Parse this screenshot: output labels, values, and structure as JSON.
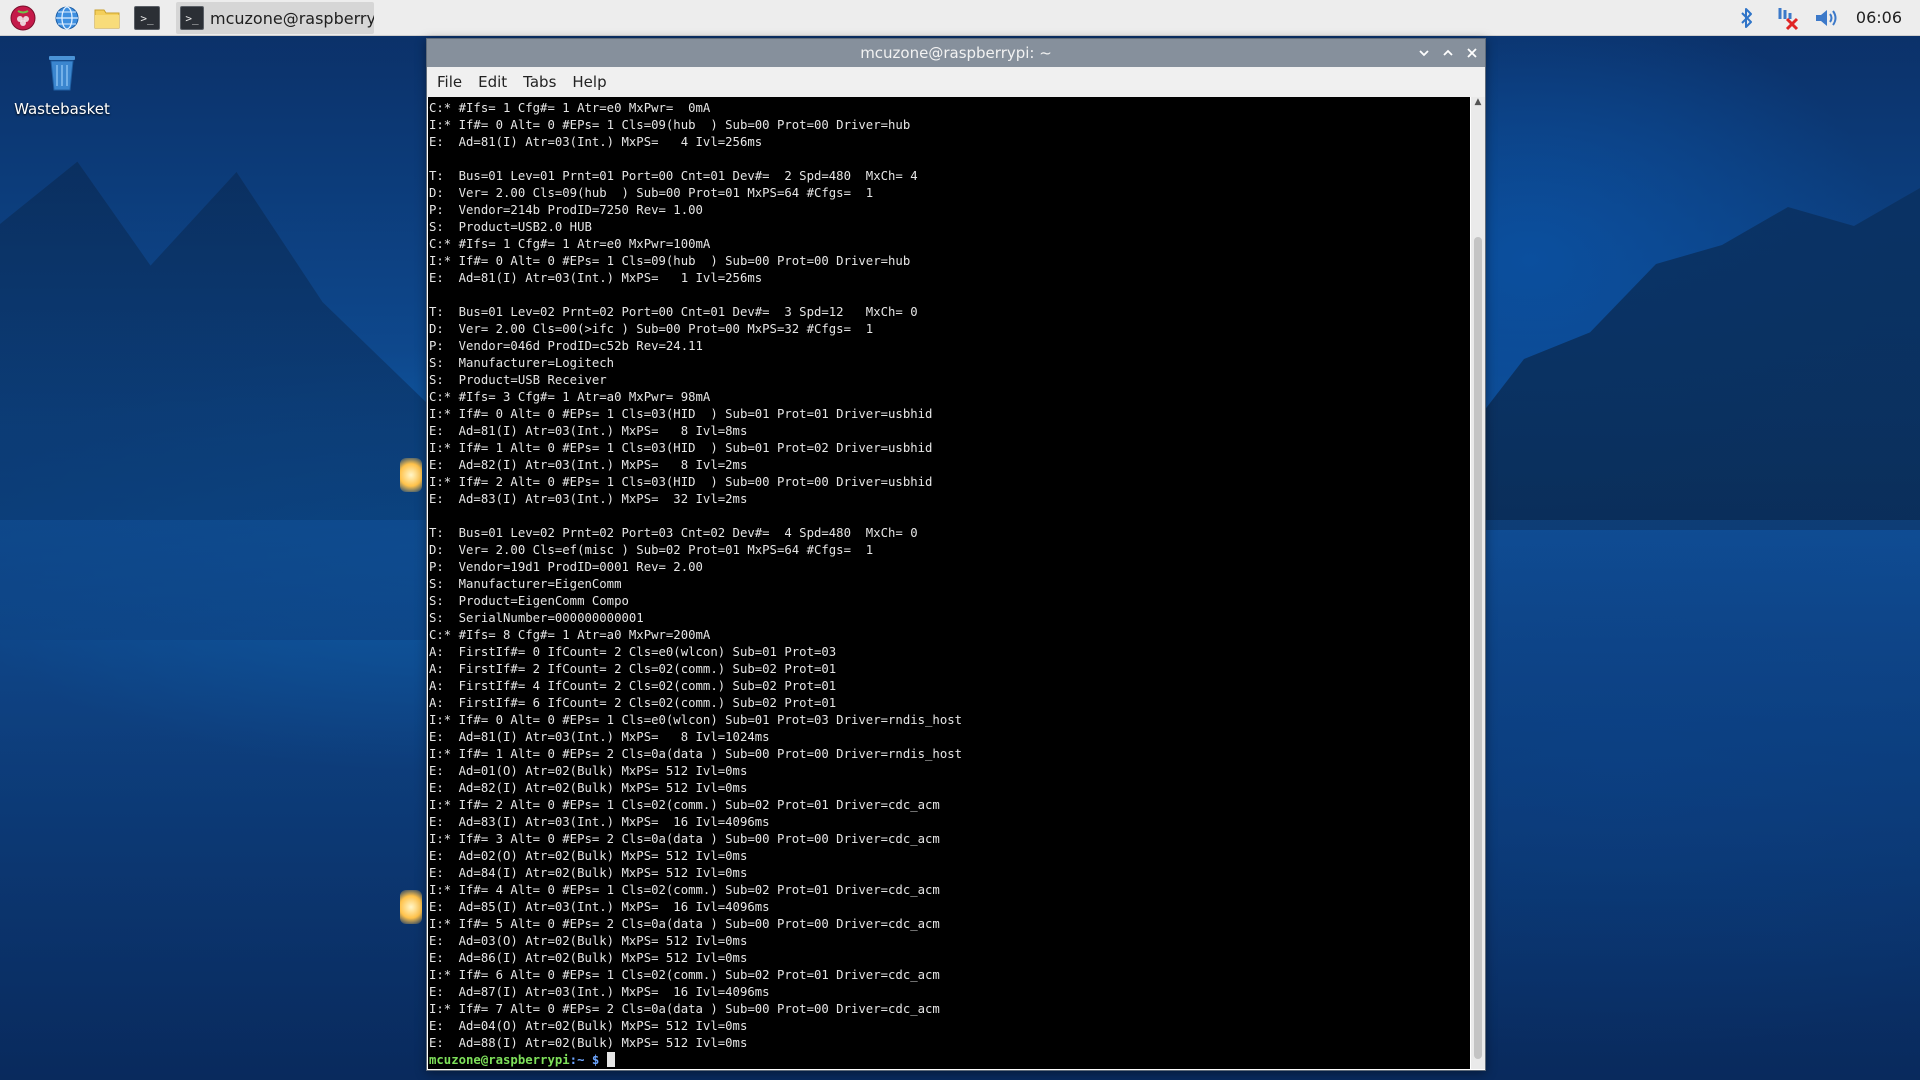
{
  "panel": {
    "task_label": "mcuzone@raspberry...",
    "clock": "06:06",
    "task_icon_glyph": ">_",
    "launcher_icons": [
      "raspberry-menu-icon",
      "web-browser-icon",
      "file-manager-icon",
      "terminal-icon"
    ],
    "tray_icons": [
      "bluetooth-icon",
      "network-disconnected-icon",
      "volume-icon"
    ]
  },
  "desktop": {
    "wastebasket_label": "Wastebasket"
  },
  "window": {
    "title": "mcuzone@raspberrypi: ~",
    "controls": [
      "minimize",
      "maximize",
      "close"
    ]
  },
  "menubar": {
    "file": "File",
    "edit": "Edit",
    "tabs": "Tabs",
    "help": "Help"
  },
  "terminal": {
    "output": "C:* #Ifs= 1 Cfg#= 1 Atr=e0 MxPwr=  0mA\nI:* If#= 0 Alt= 0 #EPs= 1 Cls=09(hub  ) Sub=00 Prot=00 Driver=hub\nE:  Ad=81(I) Atr=03(Int.) MxPS=   4 Ivl=256ms\n\nT:  Bus=01 Lev=01 Prnt=01 Port=00 Cnt=01 Dev#=  2 Spd=480  MxCh= 4\nD:  Ver= 2.00 Cls=09(hub  ) Sub=00 Prot=01 MxPS=64 #Cfgs=  1\nP:  Vendor=214b ProdID=7250 Rev= 1.00\nS:  Product=USB2.0 HUB\nC:* #Ifs= 1 Cfg#= 1 Atr=e0 MxPwr=100mA\nI:* If#= 0 Alt= 0 #EPs= 1 Cls=09(hub  ) Sub=00 Prot=00 Driver=hub\nE:  Ad=81(I) Atr=03(Int.) MxPS=   1 Ivl=256ms\n\nT:  Bus=01 Lev=02 Prnt=02 Port=00 Cnt=01 Dev#=  3 Spd=12   MxCh= 0\nD:  Ver= 2.00 Cls=00(>ifc ) Sub=00 Prot=00 MxPS=32 #Cfgs=  1\nP:  Vendor=046d ProdID=c52b Rev=24.11\nS:  Manufacturer=Logitech\nS:  Product=USB Receiver\nC:* #Ifs= 3 Cfg#= 1 Atr=a0 MxPwr= 98mA\nI:* If#= 0 Alt= 0 #EPs= 1 Cls=03(HID  ) Sub=01 Prot=01 Driver=usbhid\nE:  Ad=81(I) Atr=03(Int.) MxPS=   8 Ivl=8ms\nI:* If#= 1 Alt= 0 #EPs= 1 Cls=03(HID  ) Sub=01 Prot=02 Driver=usbhid\nE:  Ad=82(I) Atr=03(Int.) MxPS=   8 Ivl=2ms\nI:* If#= 2 Alt= 0 #EPs= 1 Cls=03(HID  ) Sub=00 Prot=00 Driver=usbhid\nE:  Ad=83(I) Atr=03(Int.) MxPS=  32 Ivl=2ms\n\nT:  Bus=01 Lev=02 Prnt=02 Port=03 Cnt=02 Dev#=  4 Spd=480  MxCh= 0\nD:  Ver= 2.00 Cls=ef(misc ) Sub=02 Prot=01 MxPS=64 #Cfgs=  1\nP:  Vendor=19d1 ProdID=0001 Rev= 2.00\nS:  Manufacturer=EigenComm\nS:  Product=EigenComm Compo\nS:  SerialNumber=000000000001\nC:* #Ifs= 8 Cfg#= 1 Atr=a0 MxPwr=200mA\nA:  FirstIf#= 0 IfCount= 2 Cls=e0(wlcon) Sub=01 Prot=03\nA:  FirstIf#= 2 IfCount= 2 Cls=02(comm.) Sub=02 Prot=01\nA:  FirstIf#= 4 IfCount= 2 Cls=02(comm.) Sub=02 Prot=01\nA:  FirstIf#= 6 IfCount= 2 Cls=02(comm.) Sub=02 Prot=01\nI:* If#= 0 Alt= 0 #EPs= 1 Cls=e0(wlcon) Sub=01 Prot=03 Driver=rndis_host\nE:  Ad=81(I) Atr=03(Int.) MxPS=   8 Ivl=1024ms\nI:* If#= 1 Alt= 0 #EPs= 2 Cls=0a(data ) Sub=00 Prot=00 Driver=rndis_host\nE:  Ad=01(O) Atr=02(Bulk) MxPS= 512 Ivl=0ms\nE:  Ad=82(I) Atr=02(Bulk) MxPS= 512 Ivl=0ms\nI:* If#= 2 Alt= 0 #EPs= 1 Cls=02(comm.) Sub=02 Prot=01 Driver=cdc_acm\nE:  Ad=83(I) Atr=03(Int.) MxPS=  16 Ivl=4096ms\nI:* If#= 3 Alt= 0 #EPs= 2 Cls=0a(data ) Sub=00 Prot=00 Driver=cdc_acm\nE:  Ad=02(O) Atr=02(Bulk) MxPS= 512 Ivl=0ms\nE:  Ad=84(I) Atr=02(Bulk) MxPS= 512 Ivl=0ms\nI:* If#= 4 Alt= 0 #EPs= 1 Cls=02(comm.) Sub=02 Prot=01 Driver=cdc_acm\nE:  Ad=85(I) Atr=03(Int.) MxPS=  16 Ivl=4096ms\nI:* If#= 5 Alt= 0 #EPs= 2 Cls=0a(data ) Sub=00 Prot=00 Driver=cdc_acm\nE:  Ad=03(O) Atr=02(Bulk) MxPS= 512 Ivl=0ms\nE:  Ad=86(I) Atr=02(Bulk) MxPS= 512 Ivl=0ms\nI:* If#= 6 Alt= 0 #EPs= 1 Cls=02(comm.) Sub=02 Prot=01 Driver=cdc_acm\nE:  Ad=87(I) Atr=03(Int.) MxPS=  16 Ivl=4096ms\nI:* If#= 7 Alt= 0 #EPs= 2 Cls=0a(data ) Sub=00 Prot=00 Driver=cdc_acm\nE:  Ad=04(O) Atr=02(Bulk) MxPS= 512 Ivl=0ms\nE:  Ad=88(I) Atr=02(Bulk) MxPS= 512 Ivl=0ms",
    "prompt_user": "mcuzone@raspberrypi",
    "prompt_path": ":~ $"
  },
  "colors": {
    "prompt_user": "#7ee05a",
    "prompt_path": "#6ea6ff",
    "titlebar": "#86909c",
    "terminal_bg": "#000000"
  }
}
